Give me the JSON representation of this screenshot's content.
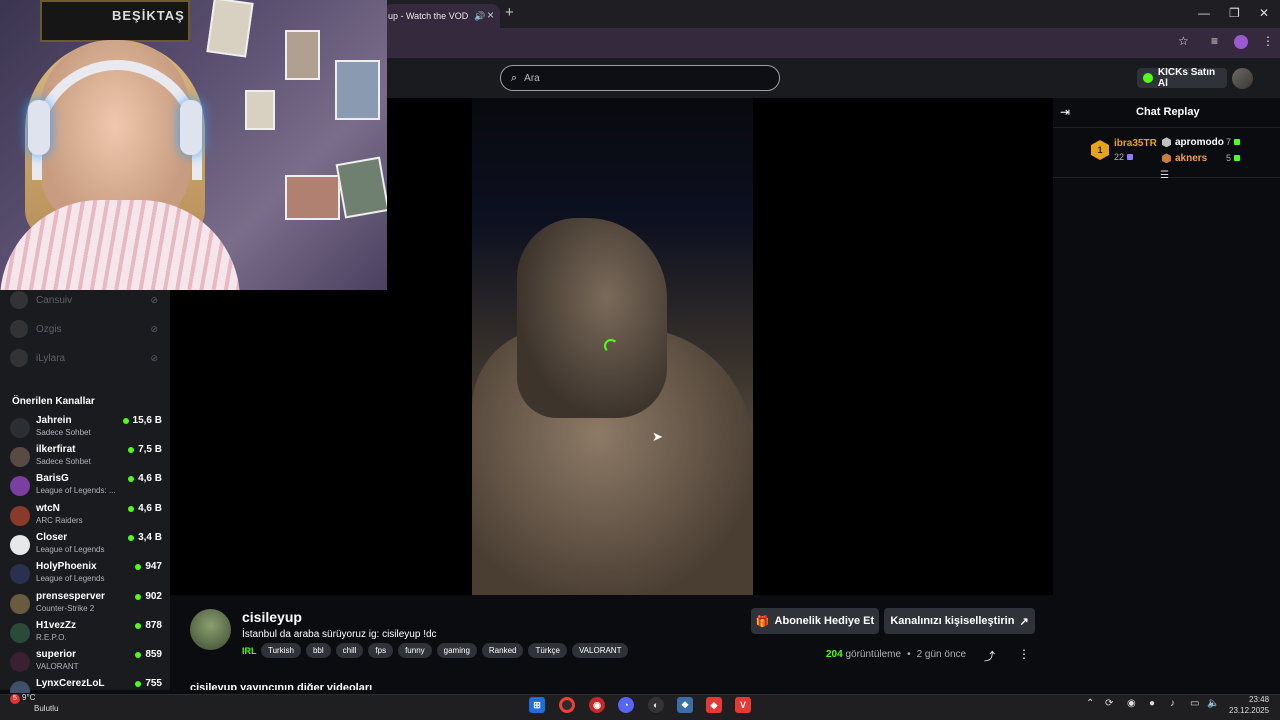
{
  "browser": {
    "tab_title": "up - Watch the VOD",
    "tab_mute_icon": "speaker-icon",
    "close_tab": "×",
    "new_tab": "+",
    "minimize": "—",
    "restore": "❐",
    "close": "✕"
  },
  "site": {
    "search_placeholder": "Ara",
    "kicks_label": "KICKs Satın Al"
  },
  "sidebar": {
    "followed": [
      {
        "name": "Cansuiv"
      },
      {
        "name": "Ozgis"
      },
      {
        "name": "iLylara"
      }
    ],
    "recommended_title": "Önerilen Kanallar",
    "channels": [
      {
        "name": "Jahrein",
        "category": "Sadece Sohbet",
        "viewers": "15,6 B",
        "color": "#2b2e33"
      },
      {
        "name": "ilkerfirat",
        "category": "Sadece Sohbet",
        "viewers": "7,5 B",
        "color": "#5a4a44"
      },
      {
        "name": "BarisG",
        "category": "League of Legends: ...",
        "viewers": "4,6 B",
        "color": "#7a3fa0"
      },
      {
        "name": "wtcN",
        "category": "ARC Raiders",
        "viewers": "4,6 B",
        "color": "#8a3a2a"
      },
      {
        "name": "Closer",
        "category": "League of Legends",
        "viewers": "3,4 B",
        "color": "#e8e8e8"
      },
      {
        "name": "HolyPhoenix",
        "category": "League of Legends",
        "viewers": "947",
        "color": "#2a3050"
      },
      {
        "name": "prensesperver",
        "category": "Counter-Strike 2",
        "viewers": "902",
        "color": "#6a5a40"
      },
      {
        "name": "H1vezZz",
        "category": "R.E.P.O.",
        "viewers": "878",
        "color": "#2a4a3a"
      },
      {
        "name": "superior",
        "category": "VALORANT",
        "viewers": "859",
        "color": "#3a2030"
      },
      {
        "name": "LynxCerezLoL",
        "category": "",
        "viewers": "755",
        "color": "#40506a"
      }
    ]
  },
  "webcam": {
    "banner_text": "BEŞİKTAŞ"
  },
  "video": {
    "streamer": "cisileyup",
    "title": "İstanbul da araba sürüyoruz  ig: cisileyup !dc",
    "category": "IRL",
    "tags": [
      "Turkish",
      "bbl",
      "chill",
      "fps",
      "funny",
      "gaming",
      "Ranked",
      "Türkçe",
      "VALORANT"
    ],
    "gift_button": "Abonelik Hediye Et",
    "customize_button": "Kanalınızı kişiselleştirin",
    "views_count": "204",
    "views_label": "görüntüleme",
    "age": "2 gün önce",
    "other_videos": "cisileyup yayıncının diğer videoları"
  },
  "chat": {
    "title": "Chat Replay",
    "top_gifter": {
      "rank": "1",
      "name": "ibra35TR",
      "count": "22"
    },
    "gifters": [
      {
        "name": "apromodo",
        "count": "7",
        "color": "#ffffff"
      },
      {
        "name": "akners",
        "count": "5",
        "color": "#f0a050"
      }
    ]
  },
  "taskbar": {
    "weather_temp": "9°C",
    "weather_desc": "Bulutlu",
    "weather_badge": "5",
    "time": "23:48",
    "date": "23.12.2025"
  }
}
